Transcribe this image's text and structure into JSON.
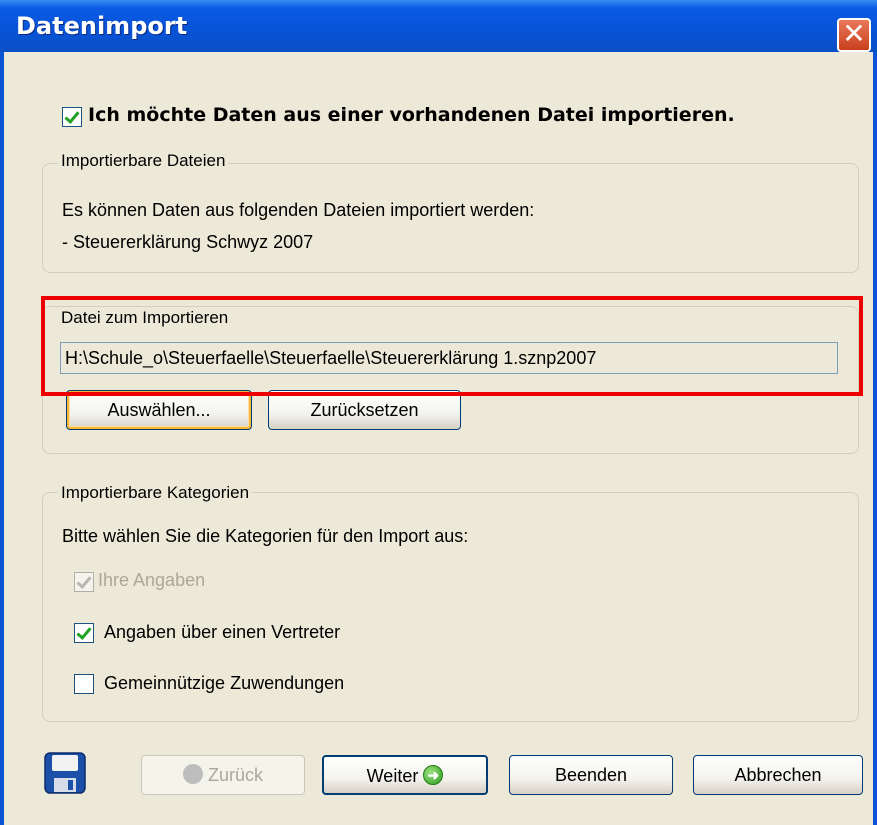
{
  "window": {
    "title": "Datenimport",
    "close_glyph": "✕"
  },
  "import_checkbox": {
    "label": "Ich möchte Daten aus einer vorhandenen Datei importieren.",
    "checked": true
  },
  "importable_files": {
    "legend": "Importierbare Dateien",
    "description": "Es können Daten aus folgenden Dateien importiert werden:",
    "items": [
      "- Steuererklärung Schwyz 2007"
    ]
  },
  "file_to_import": {
    "legend": "Datei zum Importieren",
    "path": "H:\\Schule_o\\Steuerfaelle\\Steuerfaelle\\Steuererklärung 1.sznp2007",
    "select_label": "Auswählen...",
    "reset_label": "Zurücksetzen"
  },
  "categories": {
    "legend": "Importierbare Kategorien",
    "instruction": "Bitte wählen Sie die Kategorien für den Import aus:",
    "items": [
      {
        "label": "Ihre Angaben",
        "checked": true,
        "disabled": true
      },
      {
        "label": "Angaben über einen Vertreter",
        "checked": true,
        "disabled": false
      },
      {
        "label": "Gemeinnützige Zuwendungen",
        "checked": false,
        "disabled": false
      }
    ]
  },
  "footer": {
    "back_label": "Zurück",
    "next_label": "Weiter",
    "finish_label": "Beenden",
    "cancel_label": "Abbrechen"
  },
  "icons": {
    "save": "floppy-disk-icon",
    "back": "arrow-left-circle-icon",
    "next": "arrow-right-circle-icon",
    "close": "close-icon"
  },
  "colors": {
    "titlebar": "#0853D6",
    "highlight": "#EE0000",
    "dialog_bg": "#ECE9D8"
  }
}
